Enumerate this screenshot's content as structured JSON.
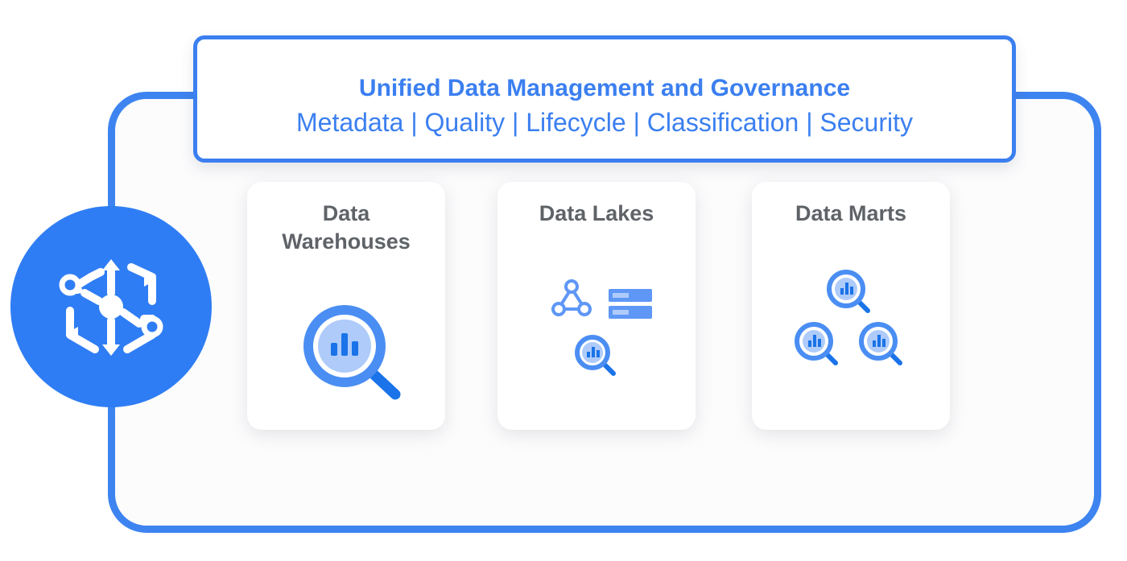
{
  "governance": {
    "title": "Unified Data Management and Governance",
    "subtitle": "Metadata | Quality | Lifecycle | Classification | Security"
  },
  "hub": {
    "icon": "dataplex-hub-icon"
  },
  "cards": [
    {
      "title_line1": "Data",
      "title_line2": "Warehouses",
      "icon": "bigquery-search-icon"
    },
    {
      "title": "Data Lakes",
      "icons": [
        "network-nodes-icon",
        "storage-server-icon",
        "bigquery-search-icon"
      ]
    },
    {
      "title": "Data Marts",
      "icons": [
        "bigquery-search-icon",
        "bigquery-search-icon",
        "bigquery-search-icon"
      ]
    }
  ],
  "colors": {
    "accent": "#3b7ff0",
    "hub": "#2f7df4",
    "icon_light": "#aecbfa",
    "icon_dark": "#1a73e8",
    "card_title": "#5f6368"
  }
}
